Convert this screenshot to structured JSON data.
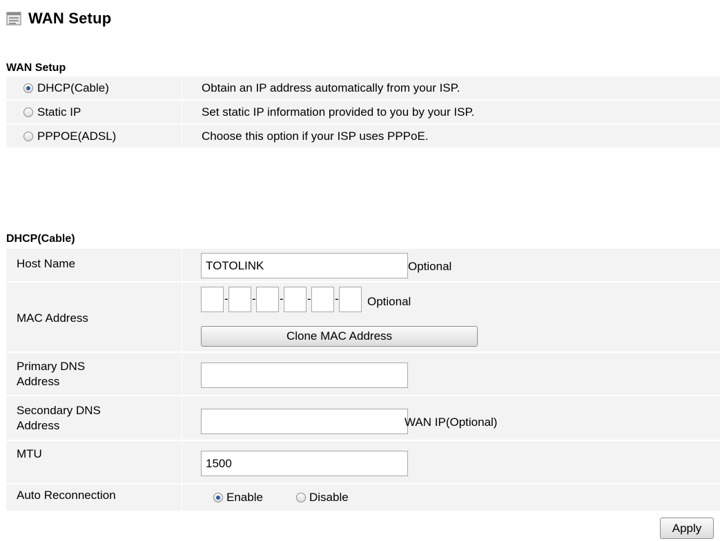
{
  "page_title": "WAN Setup",
  "wan_section": {
    "title": "WAN Setup",
    "options": [
      {
        "label": "DHCP(Cable)",
        "desc": "Obtain an IP address automatically from your ISP.",
        "checked": true
      },
      {
        "label": "Static IP",
        "desc": "Set static IP information provided to you by your ISP.",
        "checked": false
      },
      {
        "label": "PPPOE(ADSL)",
        "desc": "Choose this option if your ISP uses PPPoE.",
        "checked": false
      }
    ]
  },
  "dhcp_section": {
    "title": "DHCP(Cable)",
    "host_name": {
      "label": "Host Name",
      "value": "TOTOLINK",
      "hint": "Optional"
    },
    "mac_address": {
      "label": "MAC Address",
      "octets": [
        "",
        "",
        "",
        "",
        "",
        ""
      ],
      "separator": "-",
      "hint": "Optional",
      "clone_button": "Clone MAC Address"
    },
    "primary_dns": {
      "label_line1": "Primary DNS",
      "label_line2": "Address",
      "value": ""
    },
    "secondary_dns": {
      "label_line1": "Secondary DNS",
      "label_line2": "Address",
      "value": "",
      "hint": "WAN IP(Optional)"
    },
    "mtu": {
      "label": "MTU",
      "value": "1500"
    },
    "auto_reconnection": {
      "label": "Auto Reconnection",
      "enable_label": "Enable",
      "disable_label": "Disable",
      "selected": "Enable"
    }
  },
  "apply_button": "Apply"
}
